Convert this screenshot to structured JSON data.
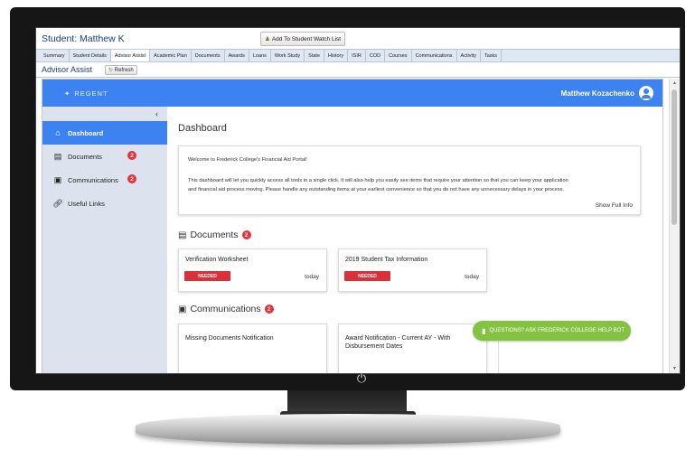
{
  "student_header": {
    "title": "Student: Matthew K",
    "watch_button": "Add To Student Watch List"
  },
  "tabs": [
    {
      "label": "Summary"
    },
    {
      "label": "Student Details"
    },
    {
      "label": "Advisor Assist"
    },
    {
      "label": "Academic Plan"
    },
    {
      "label": "Documents"
    },
    {
      "label": "Awards"
    },
    {
      "label": "Loans"
    },
    {
      "label": "Work Study"
    },
    {
      "label": "State"
    },
    {
      "label": "History"
    },
    {
      "label": "ISIR"
    },
    {
      "label": "COD"
    },
    {
      "label": "Courses"
    },
    {
      "label": "Communications"
    },
    {
      "label": "Activity"
    },
    {
      "label": "Tasks"
    }
  ],
  "active_tab": "Advisor Assist",
  "subheader": {
    "title": "Advisor Assist",
    "refresh": "Refresh"
  },
  "app": {
    "logo": "REGENT",
    "user_name": "Matthew Kozachenko",
    "accent_color": "#3c82f0",
    "badge_color": "#e8313a"
  },
  "sidebar": {
    "collapse_icon": "‹",
    "items": [
      {
        "label": "Dashboard",
        "icon": "home-icon"
      },
      {
        "label": "Documents",
        "icon": "documents-icon",
        "badge": "2"
      },
      {
        "label": "Communications",
        "icon": "message-icon",
        "badge": "2"
      },
      {
        "label": "Useful Links",
        "icon": "link-icon"
      }
    ]
  },
  "dashboard": {
    "title": "Dashboard",
    "welcome": {
      "line1": "Welcome to Frederick College's Financial Aid Portal!",
      "line2": "This dashboard will let you quickly access all tools in a single click. It will also help you easily see items that require your attention so that you can keep your application",
      "line3": "and financial aid process moving. Please handle any outstanding items at your earliest convenience so that you do not have any unnecessary delays in your process.",
      "show_full": "Show Full Info"
    },
    "documents": {
      "title": "Documents",
      "badge": "2",
      "cards": [
        {
          "title": "Verification Worksheet",
          "status": "NEEDED",
          "date": "today"
        },
        {
          "title": "2019 Student Tax Information",
          "status": "NEEDED",
          "date": "today"
        }
      ]
    },
    "communications": {
      "title": "Communications",
      "badge": "2",
      "cards": [
        {
          "title": "Missing Documents Notification"
        },
        {
          "title": "Award Notification - Current AY - With",
          "title_line2": "Disbursement Dates"
        }
      ]
    },
    "helpbot": "QUESTIONS? ASK FREDERICK COLLEGE HELP BOT"
  }
}
